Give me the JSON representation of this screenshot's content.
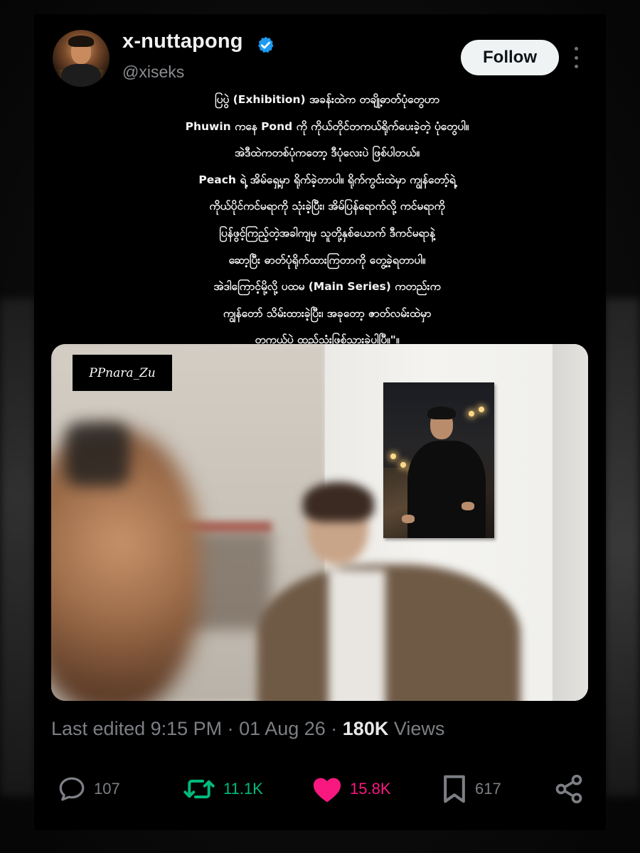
{
  "author": {
    "display_name": "x-nuttapong",
    "handle": "@xiseks",
    "verified": true
  },
  "follow_label": "Follow",
  "post_lines": [
    "ပြပွဲ (Exhibition) အခန်းထဲက တချို့ဓာတ်ပုံတွေဟာ",
    "Phuwin ကနေ Pond ကို ကိုယ်တိုင်တကယ်ရိုက်ပေးခဲ့တဲ့ ပုံတွေပါ။",
    "အဲဒီထဲကတစ်ပုံကတော့ ဒီပုံလေးပဲ ဖြစ်ပါတယ်။",
    "Peach ရဲ့ အိမ်ရှေ့မှာ ရိုက်ခဲ့တာပါ။ ရိုက်ကွင်းထဲမှာ ကျွန်တော့်ရဲ့",
    "ကိုယ်ပိုင်ကင်မရာကို သုံးခဲ့ပြီး၊ အိမ်ပြန်ရောက်လို့ ကင်မရာကို",
    "ပြန်ဖွင့်ကြည့်တဲ့အခါကျမှ သူတို့နှစ်ယောက် ဒီကင်မရာနဲ့",
    "ဆော့ပြီး ဓာတ်ပုံရိုက်ထားကြတာကို တွေ့ခဲ့ရတာပါ။",
    "အဲဒါကြောင့်မို့လို့ ပထမ  (Main Series) ကတည်းက",
    "ကျွန်တော် သိမ်းထားခဲ့ပြီး၊ အခုတော့ ဇာတ်လမ်းထဲမှာ",
    "တကယ်ပဲ ထည့်သုံးဖြစ်သွားခဲ့ပါပြီ။\"။"
  ],
  "media": {
    "watermark": "PPnara_Zu"
  },
  "meta": {
    "edited_label": "Last edited 9:15 PM",
    "sep1": " · ",
    "date": "01 Aug 26",
    "sep2": " · ",
    "views_count": "180K",
    "views_label": " Views"
  },
  "actions": {
    "replies": "107",
    "reposts": "11.1K",
    "likes": "15.8K",
    "bookmarks": "617"
  },
  "colors": {
    "background": "#000000",
    "text": "#f1f1f1",
    "muted": "#7c7f84",
    "verified": "#1d9bf0",
    "repost": "#00ba7c",
    "like": "#f91880",
    "follow_bg": "#eff3f4"
  },
  "icons": {
    "verified": "verified-badge-icon",
    "more": "more-vertical-icon",
    "reply": "reply-icon",
    "repost": "repost-icon",
    "like": "heart-icon",
    "bookmark": "bookmark-icon",
    "share": "share-icon"
  }
}
